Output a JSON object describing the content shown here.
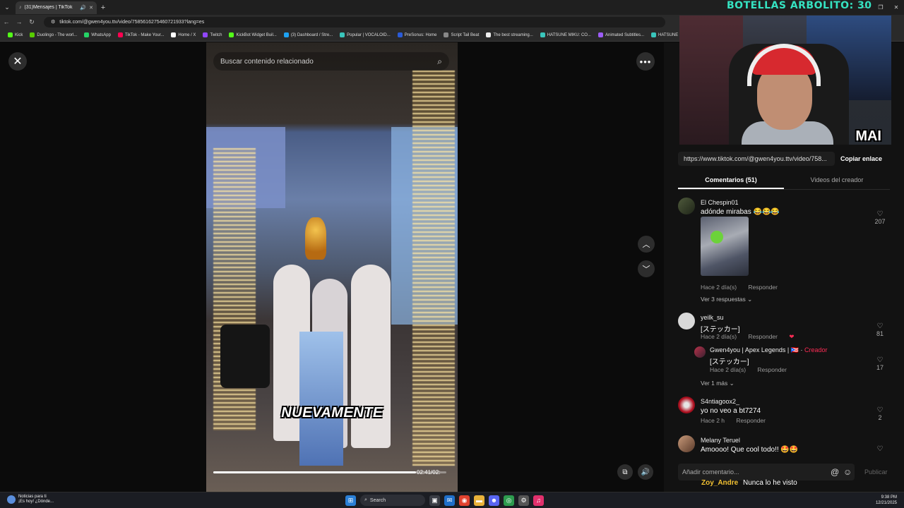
{
  "browser": {
    "tab_title": "(31)Mensajes | TikTok",
    "url": "tiktok.com/@gwen4you.ttv/video/7585616275460721933?lang=es",
    "bookmarks": [
      "Kick",
      "Duolingo - The worl...",
      "WhatsApp",
      "TikTok - Make Your...",
      "Home / X",
      "Twitch",
      "KickBot Widget Buil...",
      "(3) Dashboard / Stre...",
      "Popular | VOCALOID...",
      "PreSonus: Home",
      "Script Tail Beat",
      "The best streaming...",
      "HATSUNE MIKU: CO...",
      "Animated Subtitles...",
      "HATSUNE M"
    ]
  },
  "video": {
    "search_placeholder": "Buscar contenido relacionado",
    "caption": "NUEVAMENTE",
    "timecode": "02:41/02:",
    "progress": 0.87
  },
  "side": {
    "share_link": "https://www.tiktok.com/@gwen4you.ttv/video/758...",
    "copy_label": "Copiar enlace",
    "tabs": [
      {
        "label": "Comentarios (51)",
        "active": true
      },
      {
        "label": "Videos del creador",
        "active": false
      }
    ],
    "reply_label": "Responder",
    "comments": [
      {
        "user": "El Chespin01",
        "text": "adónde mirabas 😂😂😂",
        "meta": "Hace 2 día(s)",
        "likes": "207",
        "more": "Ver 3 respuestas"
      },
      {
        "user": "yeilk_su",
        "text": "[ステッカー]",
        "meta": "Hace 2 día(s)",
        "likes": "81",
        "reply": {
          "user": "Gwen4you | Apex Legends | 🇵🇷 ·",
          "badge": "Creador",
          "text": "[ステッカー]",
          "meta": "Hace 2 día(s)",
          "likes": "17"
        },
        "more": "Ver 1 más"
      },
      {
        "user": "S4ntiagoox2_",
        "text": "yo no veo a bt7274",
        "meta": "Hace 2 h",
        "likes": "2"
      },
      {
        "user": "Melany Teruel",
        "text": "Amoooo! Que cool todo!! 🤩🤩",
        "meta": "",
        "likes": ""
      }
    ],
    "comment_placeholder": "Añadir comentario...",
    "publish_label": "Publicar"
  },
  "stream": {
    "title": "BOTELLAS ARBOLITO: 30",
    "webcam_tag": "MAI",
    "viewer_name": "Zoy_Andre",
    "viewer_message": "Nunca lo he visto"
  },
  "taskbar": {
    "news_title": "Noticias para ti",
    "news_sub": "¡Es hoy! ¿Dónde...",
    "search": "Search",
    "time": "9:38 PM",
    "date": "12/21/2025"
  }
}
